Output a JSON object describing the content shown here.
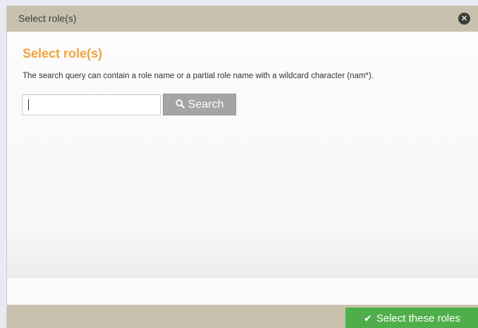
{
  "dialog": {
    "title": "Select role(s)",
    "close_icon": "close-circle-icon"
  },
  "content": {
    "heading": "Select role(s)",
    "description": "The search query can contain a role name or a partial role name with a wildcard character (nam*).",
    "search": {
      "value": "",
      "placeholder": "",
      "button_label": "Search",
      "button_icon": "search-icon"
    }
  },
  "footer": {
    "select_button_label": "Select these roles",
    "select_button_icon": "check-icon"
  },
  "colors": {
    "titlebar": "#c7c1ae",
    "heading_accent": "#f0a23c",
    "search_button": "#a4a4a4",
    "select_button": "#4fae4a"
  }
}
